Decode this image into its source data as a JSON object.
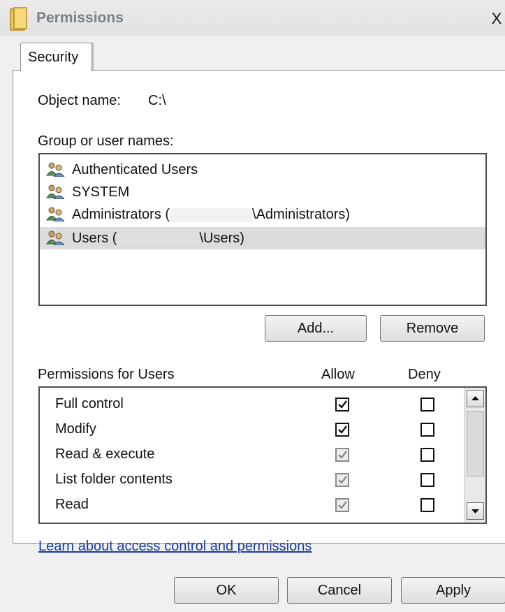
{
  "window": {
    "title": "Permissions",
    "close_glyph": "X"
  },
  "tabs": [
    {
      "label": "Security"
    }
  ],
  "object": {
    "label": "Object name:",
    "value": "C:\\"
  },
  "groups": {
    "label": "Group or user names:",
    "items": [
      {
        "prefix": "Authenticated Users",
        "suffix": ""
      },
      {
        "prefix": "SYSTEM",
        "suffix": ""
      },
      {
        "prefix": "Administrators (",
        "suffix": "\\Administrators)"
      },
      {
        "prefix": "Users (",
        "suffix": "\\Users)"
      }
    ],
    "selected_index": 3
  },
  "buttons": {
    "add": "Add...",
    "remove": "Remove",
    "ok": "OK",
    "cancel": "Cancel",
    "apply": "Apply"
  },
  "permissions": {
    "label": "Permissions for Users",
    "col_allow": "Allow",
    "col_deny": "Deny",
    "rows": [
      {
        "name": "Full control",
        "allow": "checked",
        "deny": "unchecked"
      },
      {
        "name": "Modify",
        "allow": "checked",
        "deny": "unchecked"
      },
      {
        "name": "Read & execute",
        "allow": "checked-inherited",
        "deny": "unchecked"
      },
      {
        "name": "List folder contents",
        "allow": "checked-inherited",
        "deny": "unchecked"
      },
      {
        "name": "Read",
        "allow": "checked-inherited",
        "deny": "unchecked"
      }
    ]
  },
  "link": {
    "text": "Learn about access control and permissions"
  },
  "icons": {
    "title": "folder-icon",
    "user": "users-icon",
    "close": "close-icon"
  },
  "colors": {
    "link": "#1b3fa0",
    "selection": "#dcdcdc",
    "title_text": "#7a8088"
  }
}
